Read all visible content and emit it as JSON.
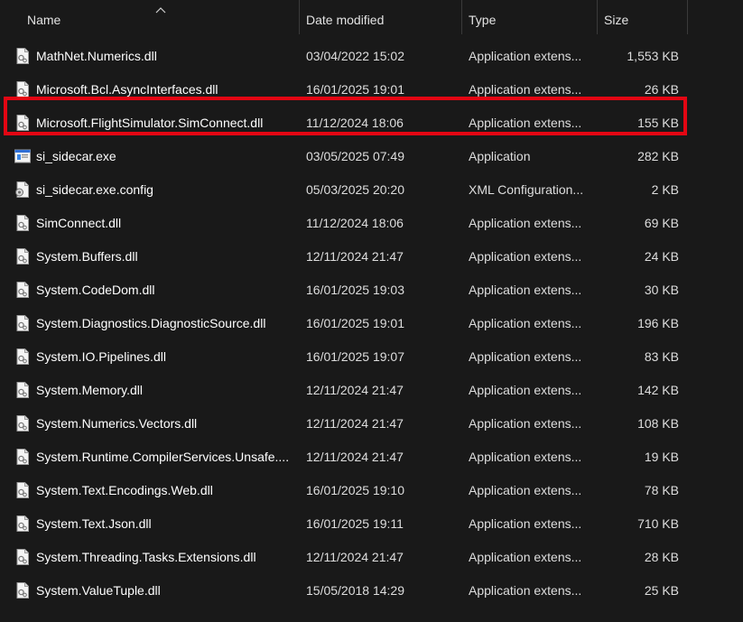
{
  "columns": {
    "name": "Name",
    "date_modified": "Date modified",
    "type": "Type",
    "size": "Size"
  },
  "sort": {
    "column": "Name",
    "direction": "ascending"
  },
  "highlight_color": "#e30613",
  "files": [
    {
      "name": "MathNet.Numerics.dll",
      "date": "03/04/2022 15:02",
      "type": "Application extens...",
      "size": "1,553 KB",
      "icon": "dll-file-icon"
    },
    {
      "name": "Microsoft.Bcl.AsyncInterfaces.dll",
      "date": "16/01/2025 19:01",
      "type": "Application extens...",
      "size": "26 KB",
      "icon": "dll-file-icon"
    },
    {
      "name": "Microsoft.FlightSimulator.SimConnect.dll",
      "date": "11/12/2024 18:06",
      "type": "Application extens...",
      "size": "155 KB",
      "icon": "dll-file-icon"
    },
    {
      "name": "si_sidecar.exe",
      "date": "03/05/2025 07:49",
      "type": "Application",
      "size": "282 KB",
      "icon": "exe-file-icon",
      "highlighted": true
    },
    {
      "name": "si_sidecar.exe.config",
      "date": "05/03/2025 20:20",
      "type": "XML Configuration...",
      "size": "2 KB",
      "icon": "config-file-icon"
    },
    {
      "name": "SimConnect.dll",
      "date": "11/12/2024 18:06",
      "type": "Application extens...",
      "size": "69 KB",
      "icon": "dll-file-icon"
    },
    {
      "name": "System.Buffers.dll",
      "date": "12/11/2024 21:47",
      "type": "Application extens...",
      "size": "24 KB",
      "icon": "dll-file-icon"
    },
    {
      "name": "System.CodeDom.dll",
      "date": "16/01/2025 19:03",
      "type": "Application extens...",
      "size": "30 KB",
      "icon": "dll-file-icon"
    },
    {
      "name": "System.Diagnostics.DiagnosticSource.dll",
      "date": "16/01/2025 19:01",
      "type": "Application extens...",
      "size": "196 KB",
      "icon": "dll-file-icon"
    },
    {
      "name": "System.IO.Pipelines.dll",
      "date": "16/01/2025 19:07",
      "type": "Application extens...",
      "size": "83 KB",
      "icon": "dll-file-icon"
    },
    {
      "name": "System.Memory.dll",
      "date": "12/11/2024 21:47",
      "type": "Application extens...",
      "size": "142 KB",
      "icon": "dll-file-icon"
    },
    {
      "name": "System.Numerics.Vectors.dll",
      "date": "12/11/2024 21:47",
      "type": "Application extens...",
      "size": "108 KB",
      "icon": "dll-file-icon"
    },
    {
      "name": "System.Runtime.CompilerServices.Unsafe....",
      "date": "12/11/2024 21:47",
      "type": "Application extens...",
      "size": "19 KB",
      "icon": "dll-file-icon"
    },
    {
      "name": "System.Text.Encodings.Web.dll",
      "date": "16/01/2025 19:10",
      "type": "Application extens...",
      "size": "78 KB",
      "icon": "dll-file-icon"
    },
    {
      "name": "System.Text.Json.dll",
      "date": "16/01/2025 19:11",
      "type": "Application extens...",
      "size": "710 KB",
      "icon": "dll-file-icon"
    },
    {
      "name": "System.Threading.Tasks.Extensions.dll",
      "date": "12/11/2024 21:47",
      "type": "Application extens...",
      "size": "28 KB",
      "icon": "dll-file-icon"
    },
    {
      "name": "System.ValueTuple.dll",
      "date": "15/05/2018 14:29",
      "type": "Application extens...",
      "size": "25 KB",
      "icon": "dll-file-icon"
    }
  ]
}
